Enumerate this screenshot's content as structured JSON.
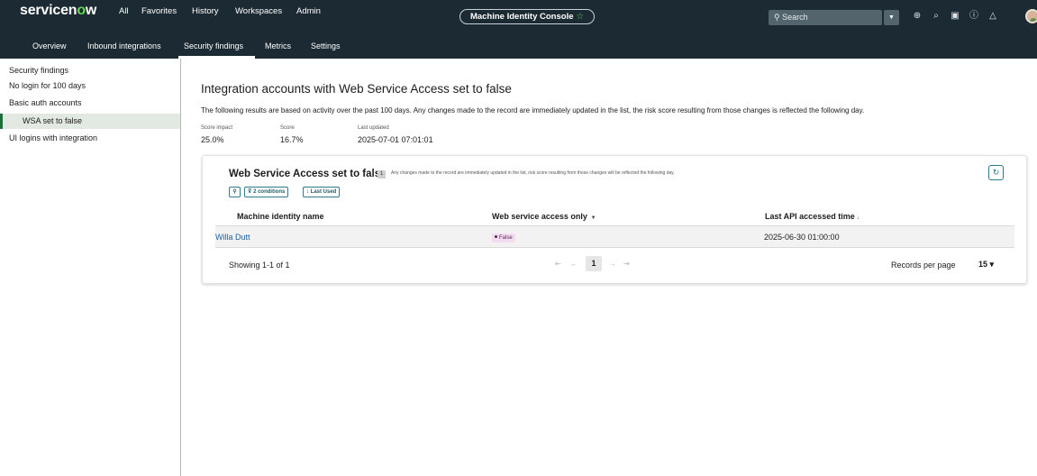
{
  "header": {
    "logo": "servicenow",
    "nav": [
      "All",
      "Favorites",
      "History",
      "Workspaces",
      "Admin"
    ],
    "console_title": "Machine Identity Console",
    "console_star": "☆",
    "search_placeholder": "Search"
  },
  "tabs": [
    {
      "label": "Overview"
    },
    {
      "label": "Inbound integrations"
    },
    {
      "label": "Security findings",
      "active": true
    },
    {
      "label": "Metrics"
    },
    {
      "label": "Settings"
    }
  ],
  "sidebar": {
    "items": [
      {
        "label": "Security findings"
      },
      {
        "label": "No login for 100 days"
      },
      {
        "label": "Basic auth accounts"
      },
      {
        "label": "WSA set to false",
        "selected": true
      },
      {
        "label": "UI logins with integration"
      }
    ]
  },
  "main": {
    "title": "Integration accounts with Web Service Access set to false",
    "description": "The following results are based on activity over the past 100 days. Any changes made to the record are immediately updated in the list, the risk score resulting from those changes is reflected the following day.",
    "stats": [
      {
        "label": "Score impact",
        "value": "25.0%"
      },
      {
        "label": "Score",
        "value": "16.7%"
      },
      {
        "label": "Last updated",
        "value": "2025-07-01 07:01:01"
      }
    ]
  },
  "card": {
    "title": "Web Service Access set to false",
    "count": "1",
    "note": "Any changes made to the record are immediately updated in the list, risk score resulting from those changes will be reflected the following day.",
    "filter_chip": "2 conditions",
    "sort_chip": "Last Used",
    "columns": [
      "Machine identity name",
      "Web service access only",
      "Last API accessed time"
    ],
    "rows": [
      {
        "name": "Willa Dutt",
        "wsa": "False",
        "last_api": "2025-06-30 01:00:00"
      }
    ],
    "showing": "Showing 1-1 of 1",
    "page": "1",
    "records_per_page_label": "Records per page",
    "records_per_page_value": "15"
  },
  "colors": {
    "header_bg": "#1c2b33",
    "brand_green": "#62d84e",
    "link": "#1a5f9e",
    "accent_teal": "#2b7b8c",
    "false_pill_bg": "#f2dcf0"
  }
}
